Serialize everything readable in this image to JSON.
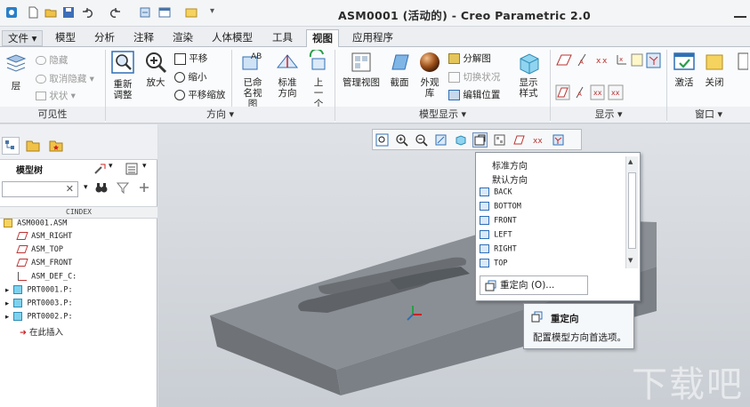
{
  "window": {
    "title": "ASM0001 (活动的) - Creo Parametric 2.0"
  },
  "tabs": [
    {
      "label": "文件 ▾"
    },
    {
      "label": "模型"
    },
    {
      "label": "分析"
    },
    {
      "label": "注释"
    },
    {
      "label": "渲染"
    },
    {
      "label": "人体模型"
    },
    {
      "label": "工具"
    },
    {
      "label": "视图"
    },
    {
      "label": "应用程序"
    }
  ],
  "ribbon": {
    "visibility": {
      "layer": "层",
      "hide": "隐藏",
      "unhide": "取消隐藏 ▾",
      "status": "状状 ▾",
      "group": "可见性"
    },
    "orientation": {
      "refit": "重新调整",
      "zoom_in": "放大",
      "pan": "平移",
      "zoom_out": "缩小",
      "pan_zoom": "平移缩放",
      "named_views": "已命名视图",
      "standard": "标准方向",
      "previous": "上一个",
      "group": "方向 ▾"
    },
    "model_display": {
      "manage_views": "管理视图",
      "section": "截面",
      "appearance": "外观库",
      "explode": "分解图",
      "toggle_status": "切换状况",
      "edit_position": "编辑位置",
      "display_style": "显示样式",
      "group": "模型显示 ▾"
    },
    "display": {
      "group": "显示 ▾"
    },
    "window": {
      "activate": "激活",
      "close": "关闭",
      "group": "窗口 ▾"
    }
  },
  "model_tree": {
    "title": "模型树",
    "search_clear": "✕",
    "index": "CINDEX",
    "items": [
      {
        "label": "ASM0001.ASM"
      },
      {
        "label": "ASM_RIGHT"
      },
      {
        "label": "ASM_TOP"
      },
      {
        "label": "ASM_FRONT"
      },
      {
        "label": "ASM_DEF_C:"
      },
      {
        "label": "PRT0001.P:"
      },
      {
        "label": "PRT0003.P:"
      },
      {
        "label": "PRT0002.P:"
      },
      {
        "label": "在此插入"
      }
    ]
  },
  "dropdown": {
    "items": [
      {
        "label": "标准方向"
      },
      {
        "label": "默认方向"
      }
    ],
    "views": [
      {
        "label": "BACK"
      },
      {
        "label": "BOTTOM"
      },
      {
        "label": "FRONT"
      },
      {
        "label": "LEFT"
      },
      {
        "label": "RIGHT"
      },
      {
        "label": "TOP"
      }
    ],
    "reorient": "重定向 (O)..."
  },
  "tooltip": {
    "title": "重定向",
    "text": "配置模型方向首选项。"
  },
  "watermark": "下载吧",
  "colors": {
    "accent": "#2f6fb5",
    "highlight": "#dce8f5",
    "model": "#7d8288"
  }
}
